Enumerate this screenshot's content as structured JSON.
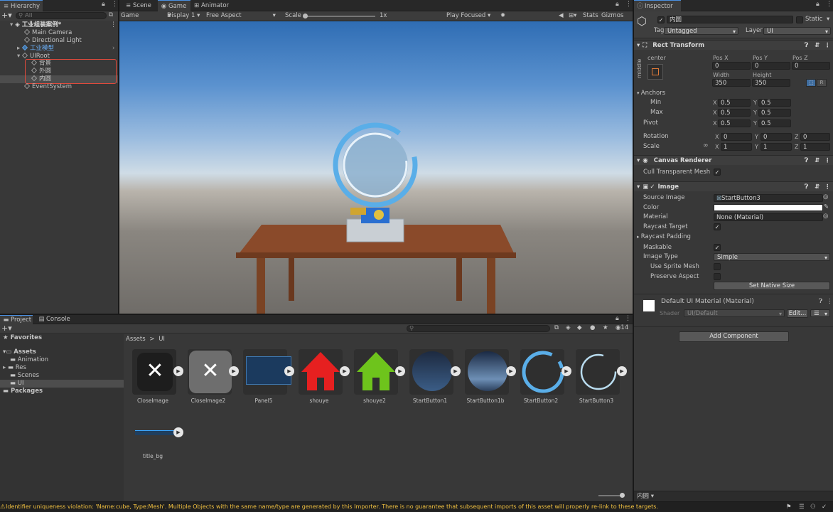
{
  "hierarchy": {
    "tab": "Hierarchy",
    "search_placeholder": "All",
    "scene": "工业组装案例*",
    "items": [
      "Main Camera",
      "Directional Light",
      "工业模型",
      "UIRoot",
      "背景",
      "外圆",
      "内圆",
      "EventSystem"
    ]
  },
  "scene_tabs": {
    "scene": "Scene",
    "game": "Game",
    "animator": "Animator"
  },
  "game_toolbar": {
    "mode": "Game",
    "display": "Display 1",
    "aspect": "Free Aspect",
    "scale_label": "Scale",
    "scale_value": "1x",
    "play_focused": "Play Focused",
    "stats": "Stats",
    "gizmos": "Gizmos"
  },
  "inspector": {
    "tab": "Inspector",
    "object_name": "内圆",
    "static": "Static",
    "tag_label": "Tag",
    "tag": "Untagged",
    "layer_label": "Layer",
    "layer": "UI",
    "rect_transform": {
      "title": "Rect Transform",
      "anchor_h": "center",
      "anchor_v": "middle",
      "pos_x_label": "Pos X",
      "pos_y_label": "Pos Y",
      "pos_z_label": "Pos Z",
      "pos_x": "0",
      "pos_y": "0",
      "pos_z": "0",
      "width_label": "Width",
      "height_label": "Height",
      "width": "350",
      "height": "350",
      "anchors": "Anchors",
      "min": "Min",
      "max": "Max",
      "pivot": "Pivot",
      "min_x": "0.5",
      "min_y": "0.5",
      "max_x": "0.5",
      "max_y": "0.5",
      "pivot_x": "0.5",
      "pivot_y": "0.5",
      "rotation": "Rotation",
      "rot_x": "0",
      "rot_y": "0",
      "rot_z": "0",
      "scale": "Scale",
      "scale_x": "1",
      "scale_y": "1",
      "scale_z": "1",
      "x": "X",
      "y": "Y",
      "z": "Z",
      "r_btn": "R"
    },
    "canvas_renderer": {
      "title": "Canvas Renderer",
      "cull": "Cull Transparent Mesh"
    },
    "image": {
      "title": "Image",
      "source_image_label": "Source Image",
      "source_image": "StartButton3",
      "color_label": "Color",
      "material_label": "Material",
      "material": "None (Material)",
      "raycast_target": "Raycast Target",
      "raycast_padding": "Raycast Padding",
      "maskable": "Maskable",
      "image_type_label": "Image Type",
      "image_type": "Simple",
      "use_sprite_mesh": "Use Sprite Mesh",
      "preserve_aspect": "Preserve Aspect",
      "set_native_size": "Set Native Size"
    },
    "material": {
      "name": "Default UI Material (Material)",
      "shader_label": "Shader",
      "shader": "UI/Default",
      "edit": "Edit..."
    },
    "add_component": "Add Component",
    "footer_name": "内圆"
  },
  "project": {
    "tab": "Project",
    "console_tab": "Console",
    "favorites": "Favorites",
    "assets": "Assets",
    "folders": [
      "Animation",
      "Res",
      "Scenes",
      "UI"
    ],
    "packages": "Packages",
    "breadcrumb_root": "Assets",
    "breadcrumb_sep": ">",
    "breadcrumb_current": "UI",
    "count": "14",
    "asset_names": [
      "CloseImage",
      "CloseImage2",
      "Panel5",
      "shouye",
      "shouye2",
      "StartButton1",
      "StartButton1b",
      "StartButton2",
      "StartButton3",
      "title_bg"
    ]
  },
  "status_message": "Identifier uniqueness violation: 'Name:cube, Type:Mesh'. Multiple Objects with the same name/type are generated by this Importer. There is no guarantee that subsequent imports of this asset will properly re-link to these targets.",
  "colors": {
    "accent": "#4a90e2",
    "selection_outline": "#e04a3c",
    "warning": "#f0c040"
  }
}
